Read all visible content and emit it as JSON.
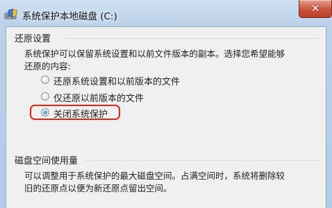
{
  "window": {
    "title": "系统保护本地磁盘 (C:)",
    "close_symbol": "✕"
  },
  "restore_settings": {
    "heading": "还原设置",
    "description_line1": "系统保护可以保留系统设置和以前文件版本的副本。选择您希望能够",
    "description_line2": "还原的内容:",
    "options": [
      {
        "label": "还原系统设置和以前版本的文件",
        "checked": false
      },
      {
        "label": "仅还原以前版本的文件",
        "checked": false
      },
      {
        "label": "关闭系统保护",
        "checked": true
      }
    ]
  },
  "disk_space": {
    "heading": "磁盘空间使用量",
    "description_line1": "可以调整用于系统保护的最大磁盘空间。占满空间时，系统将删除较",
    "description_line2": "旧的还原点以便为新还原点留出空间。"
  },
  "colors": {
    "highlight_box": "#e02418",
    "client_bg": "#f0f0f0",
    "title_bar": "#bcd2ea"
  },
  "icons": {
    "title": "drive-shield-icon",
    "close": "close-icon"
  }
}
